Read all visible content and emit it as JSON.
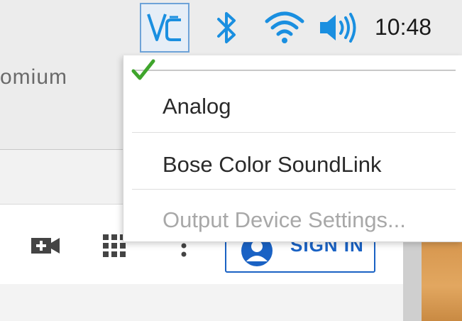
{
  "taskbar": {
    "clock": "10:48",
    "icons": [
      "vnc-icon",
      "bluetooth-icon",
      "wifi-icon",
      "volume-icon"
    ],
    "accent_color": "#1a8fe0"
  },
  "background_window": {
    "tab_title_fragment": "omium",
    "sign_in_label": "SIGN IN",
    "sign_in_color": "#1a62c4"
  },
  "audio_menu": {
    "selected_marker": "green-checkmark",
    "items": [
      {
        "label": "Analog",
        "enabled": true
      },
      {
        "label": "Bose Color SoundLink",
        "enabled": true
      },
      {
        "label": "Output Device Settings...",
        "enabled": false
      }
    ]
  }
}
